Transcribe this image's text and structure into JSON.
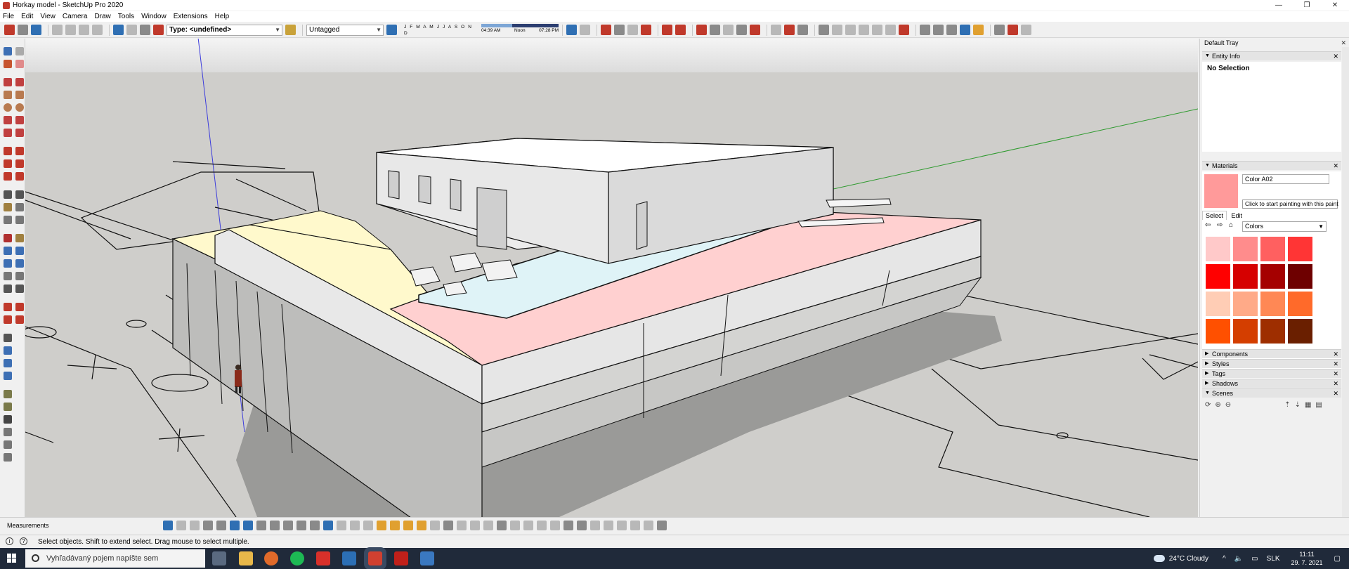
{
  "window": {
    "title": "Horkay model - SketchUp Pro 2020",
    "controls": [
      "—",
      "❐",
      "✕"
    ]
  },
  "menu": [
    "File",
    "Edit",
    "View",
    "Camera",
    "Draw",
    "Tools",
    "Window",
    "Extensions",
    "Help"
  ],
  "toolbar": {
    "type_select": "Type: <undefined>",
    "tag_select": "Untagged",
    "months": "J F M A M J J A S O N D",
    "time_start": "04:39 AM",
    "time_noon": "Noon",
    "time_end": "07:28 PM"
  },
  "tray": {
    "title": "Default Tray",
    "entity_info": {
      "label": "Entity Info",
      "value": "No Selection"
    },
    "materials": {
      "label": "Materials",
      "color_name": "Color A02",
      "tooltip": "Click to start painting with this paint",
      "tab_select": "Select",
      "tab_edit": "Edit",
      "library": "Colors",
      "preview_color": "#ff9a9a",
      "swatches": [
        "#ffc9c9",
        "#ff8c8c",
        "#ff6060",
        "#ff3535",
        "#ff0000",
        "#d60000",
        "#a50000",
        "#6e0000",
        "#ffcdb5",
        "#ffaa88",
        "#ff8855",
        "#ff6a2a",
        "#ff5000",
        "#d43e00",
        "#9e2e00",
        "#6a1f00"
      ]
    },
    "panels": [
      "Components",
      "Styles",
      "Tags",
      "Shadows",
      "Scenes"
    ]
  },
  "bottom": {
    "measurements_label": "Measurements"
  },
  "status": {
    "text": "Select objects. Shift to extend select. Drag mouse to select multiple."
  },
  "taskbar": {
    "search_placeholder": "Vyhľadávaný pojem napíšte sem",
    "weather": "24°C  Cloudy",
    "language": "SLK",
    "time": "11:11",
    "date": "29. 7. 2021"
  }
}
